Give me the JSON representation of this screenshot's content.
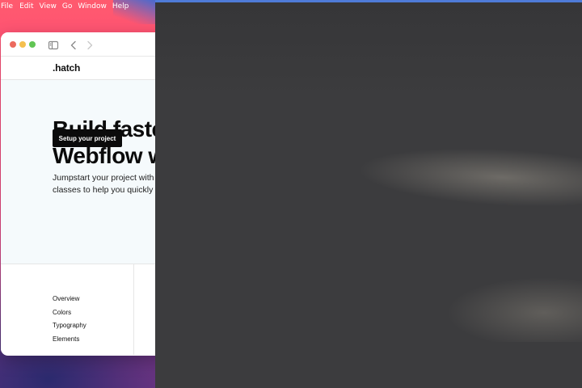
{
  "menubar": {
    "items": [
      "File",
      "Edit",
      "View",
      "Go",
      "Window",
      "Help"
    ]
  },
  "browser": {
    "traffic_lights": [
      "close",
      "minimize",
      "maximize"
    ],
    "toolbar_icons": [
      "sidebar-toggle-icon",
      "chevron-left-icon",
      "chevron-right-icon"
    ]
  },
  "site": {
    "logo": ".hatch",
    "hero": {
      "title_line1": "Build faste",
      "title_line2": "Webflow w",
      "text_line1": "Jumpstart your project with",
      "text_line2": "classes to help you quickly b",
      "cta_label": "Setup your project"
    },
    "nav": {
      "items": [
        "Overview",
        "Colors",
        "Typography",
        "Elements"
      ]
    }
  },
  "colors": {
    "overlay": "#3c3c3e",
    "hero_bg": "#f5fafc",
    "cta_bg": "#0b0b0b"
  }
}
